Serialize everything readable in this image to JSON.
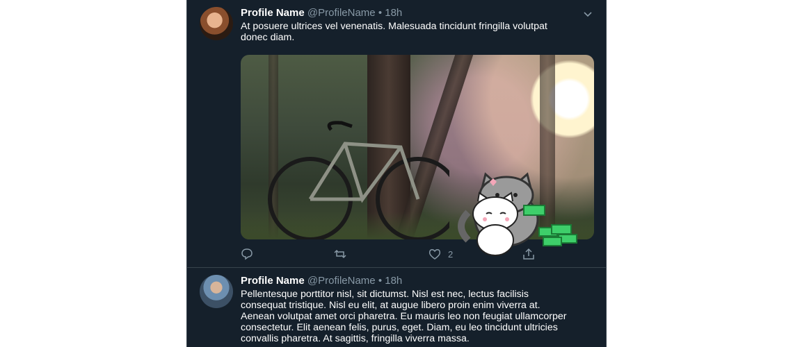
{
  "tweets": [
    {
      "name": "Profile Name",
      "handle": "@ProfileName",
      "separator": "•",
      "time": "18h",
      "text": "At posuere ultrices vel venenatis. Malesuada tincidunt fringilla volutpat donec diam.",
      "likes": "2"
    },
    {
      "name": "Profile Name",
      "handle": "@ProfileName",
      "separator": "•",
      "time": "18h",
      "text": "Pellentesque porttitor nisl, sit dictumst. Nisl est nec, lectus facilisis consequat tristique. Nisl eu elit, at augue libero proin enim viverra at. Aenean volutpat amet orci pharetra. Eu mauris leo non feugiat ullamcorper consectetur. Elit aenean felis, purus, eget. Diam, eu leo tincidunt ultricies convallis pharetra. At sagittis, fringilla viverra massa."
    }
  ],
  "icons": {
    "more": "chevron-down-icon",
    "reply": "reply-icon",
    "retweet": "retweet-icon",
    "like": "heart-icon",
    "share": "share-icon"
  },
  "colors": {
    "background": "#15202b",
    "border": "#38444d",
    "secondary_text": "#8899a6",
    "cat_sticker_money": "#3ecf6a",
    "heart_sticker": "#f4a6b8"
  }
}
